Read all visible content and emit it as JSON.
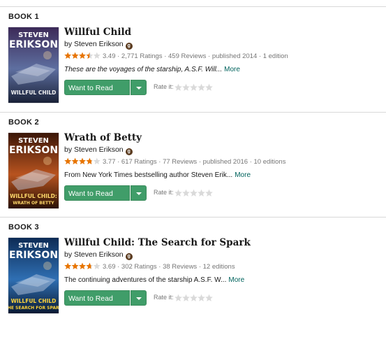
{
  "books": [
    {
      "label": "BOOK 1",
      "title": "Willful Child",
      "by": "by",
      "author": "Steven Erikson",
      "author_badge": "g",
      "avg_rating": "3.49",
      "rating_fraction": 0.698,
      "meta": "3.49 · 2,771 Ratings · 459 Reviews · published 2014 · 1 edition",
      "description": "These are the voyages of the starship, A.S.F. Will...",
      "description_italic": true,
      "more": "More",
      "want_to_read": "Want to Read",
      "rate_it": "Rate it:",
      "cover": {
        "author_line1": "STEVEN",
        "author_line2": "ERIKSON",
        "title_line1": "WILLFUL CHILD",
        "title_line2": "",
        "top_color": "#3c2a58",
        "mid_color": "#5e6fa0",
        "bottom_color": "#1a2238",
        "title_color": "#f1f1f1"
      }
    },
    {
      "label": "BOOK 2",
      "title": "Wrath of Betty",
      "by": "by",
      "author": "Steven Erikson",
      "author_badge": "g",
      "avg_rating": "3.77",
      "rating_fraction": 0.754,
      "meta": "3.77 · 617 Ratings · 77 Reviews · published 2016 · 10 editions",
      "description": "From New York Times bestselling author Steven Erik...",
      "description_italic": false,
      "more": "More",
      "want_to_read": "Want to Read",
      "rate_it": "Rate it:",
      "cover": {
        "author_line1": "STEVEN",
        "author_line2": "ERIKSON",
        "title_line1": "WILLFUL CHILD:",
        "title_line2": "WRATH OF BETTY",
        "top_color": "#3a1608",
        "mid_color": "#b8531f",
        "bottom_color": "#2a1206",
        "title_color": "#ffd86a"
      }
    },
    {
      "label": "BOOK 3",
      "title": "Willful Child: The Search for Spark",
      "by": "by",
      "author": "Steven Erikson",
      "author_badge": "g",
      "avg_rating": "3.69",
      "rating_fraction": 0.738,
      "meta": "3.69 · 302 Ratings · 38 Reviews · 12 editions",
      "description": "The continuing adventures of the starship A.S.F. W...",
      "description_italic": false,
      "more": "More",
      "want_to_read": "Want to Read",
      "rate_it": "Rate it:",
      "cover": {
        "author_line1": "STEVEN",
        "author_line2": "ERIKSON",
        "title_line1": "WILLFUL CHILD",
        "title_line2": "THE SEARCH FOR SPARK",
        "top_color": "#0d2b55",
        "mid_color": "#2f6fb3",
        "bottom_color": "#0a1a33",
        "title_color": "#ffd33a"
      }
    }
  ],
  "colors": {
    "star_filled": "#e87400",
    "star_empty": "#dadada",
    "button_green": "#409d69",
    "link_teal": "#00635d"
  }
}
